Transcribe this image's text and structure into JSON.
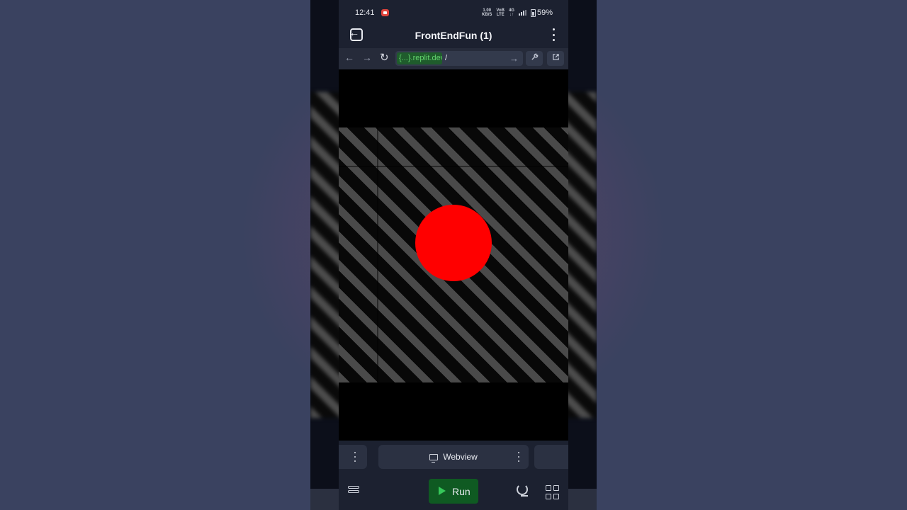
{
  "status_bar": {
    "time": "12:41",
    "speed_top": "1.00",
    "speed_bottom": "KB/S",
    "net_top": "VoB",
    "net_bottom": "LTE",
    "net2_top": "4G",
    "net2_bottom": "↓↑",
    "battery": "59%"
  },
  "header": {
    "title": "FrontEndFun (1)"
  },
  "browser": {
    "back_icon": "←",
    "forward_icon": "→",
    "reload_icon": "↻",
    "url_host": "{...}.replit.dev",
    "url_path": "/",
    "go_icon": "→",
    "devtools_icon": "wrench-icon",
    "open_external_icon": "external-link-icon"
  },
  "canvas": {
    "stripe_color": "#4a4a4a",
    "background": "#000000",
    "circle_color": "#ff0000"
  },
  "tabs": {
    "active_label": "Webview"
  },
  "bottom_bar": {
    "run_label": "Run",
    "run_color": "#0f5a22"
  }
}
